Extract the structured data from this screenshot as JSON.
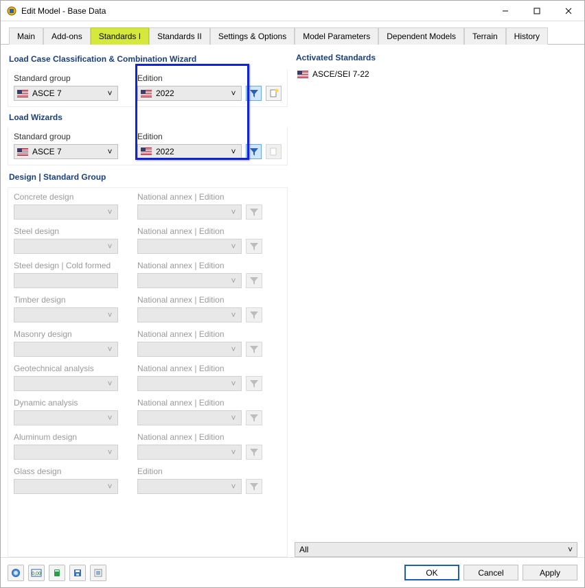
{
  "title": "Edit Model - Base Data",
  "tabs": [
    "Main",
    "Add-ons",
    "Standards I",
    "Standards II",
    "Settings & Options",
    "Model Parameters",
    "Dependent Models",
    "Terrain",
    "History"
  ],
  "active_tab": 2,
  "sections": {
    "loadcase_title": "Load Case Classification & Combination Wizard",
    "loadwiz_title": "Load Wizards",
    "design_title": "Design | Standard Group"
  },
  "labels": {
    "standard_group": "Standard group",
    "edition": "Edition",
    "national_annex_edition": "National annex | Edition"
  },
  "loadcase": {
    "standard": "ASCE 7",
    "edition": "2022"
  },
  "loadwiz": {
    "standard": "ASCE 7",
    "edition": "2022"
  },
  "design_rows": [
    {
      "label": "Concrete design",
      "annex_label": "National annex | Edition"
    },
    {
      "label": "Steel design",
      "annex_label": "National annex | Edition"
    },
    {
      "label": "Steel design | Cold formed",
      "annex_label": "National annex | Edition"
    },
    {
      "label": "Timber design",
      "annex_label": "National annex | Edition"
    },
    {
      "label": "Masonry design",
      "annex_label": "National annex | Edition"
    },
    {
      "label": "Geotechnical analysis",
      "annex_label": "National annex | Edition"
    },
    {
      "label": "Dynamic analysis",
      "annex_label": "National annex | Edition"
    },
    {
      "label": "Aluminum design",
      "annex_label": "National annex | Edition"
    },
    {
      "label": "Glass design",
      "annex_label": "Edition"
    }
  ],
  "right": {
    "title": "Activated Standards",
    "items": [
      "ASCE/SEI 7-22"
    ],
    "filter": "All"
  },
  "footer": {
    "ok": "OK",
    "cancel": "Cancel",
    "apply": "Apply"
  },
  "icons": {
    "filter": "filter-icon",
    "new": "new-icon",
    "help": "help-icon",
    "units": "units-icon",
    "calc": "calc-icon",
    "save": "save-icon",
    "list": "list-icon"
  }
}
